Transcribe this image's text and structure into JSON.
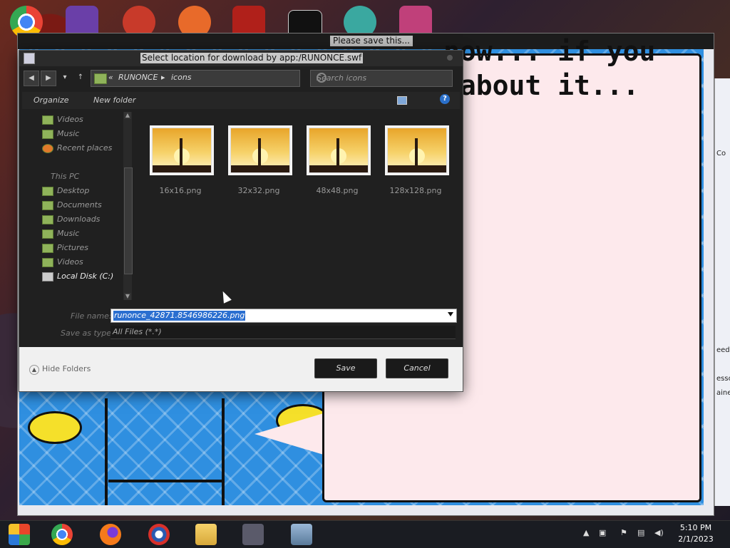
{
  "game_window": {
    "title": "Please save this...",
    "speech_text": "now... if you\n about it..."
  },
  "side_panel": [
    "Co",
    "eed:",
    "esso",
    "aine:"
  ],
  "dialog": {
    "title": "Select location for download by app:/RUNONCE.swf",
    "breadcrumbs": [
      "«",
      "RUNONCE",
      "icons"
    ],
    "search_placeholder": "Search icons",
    "toolbar": {
      "organize": "Organize",
      "new_folder": "New folder",
      "help": "?"
    },
    "nav_pane": {
      "favorites": [
        "Videos",
        "Music",
        "Recent places"
      ],
      "this_pc_header": "This PC",
      "this_pc_items": [
        "Desktop",
        "Documents",
        "Downloads",
        "Music",
        "Pictures",
        "Videos"
      ],
      "selected": "Local Disk (C:)"
    },
    "files": [
      "16x16.png",
      "32x32.png",
      "48x48.png",
      "128x128.png"
    ],
    "file_name_label": "File name:",
    "file_name_value": "runonce_42871.8546986226.png",
    "save_as_type_label": "Save as type:",
    "save_as_type_value": "All Files (*.*)",
    "hide_folders": "Hide Folders",
    "save_button": "Save",
    "cancel_button": "Cancel"
  },
  "taskbar": {
    "apps": [
      "start-icon",
      "chrome-icon",
      "firefox-icon",
      "obama-icon",
      "file-explorer-icon",
      "runonce-icon",
      "monitor-icon"
    ],
    "time": "5:10 PM",
    "date": "2/1/2023"
  },
  "colors": {
    "dialog_bg": "#202020",
    "selection": "#2b6fd0",
    "game_blue": "#2f8fe0",
    "speech_pink": "#fde9ec"
  }
}
